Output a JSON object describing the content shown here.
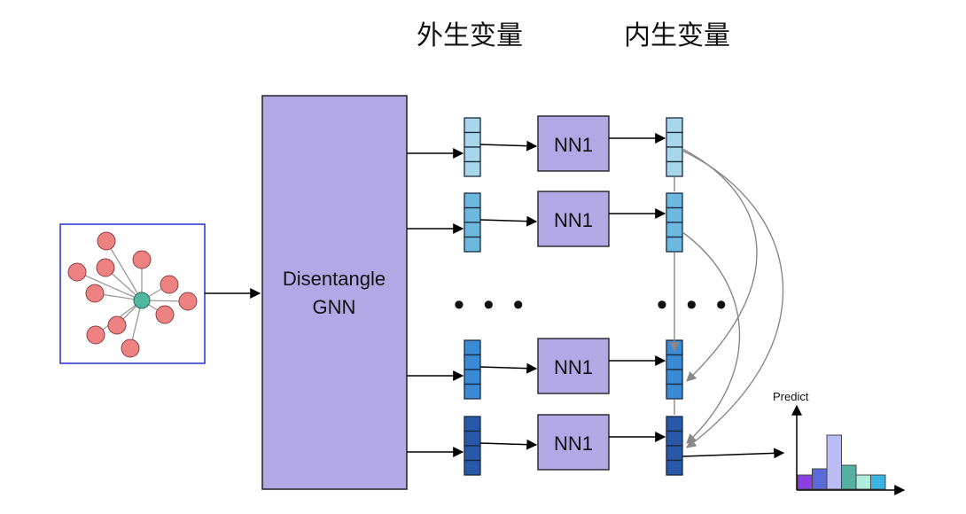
{
  "headers": {
    "exogenous": "外生变量",
    "endogenous": "内生变量"
  },
  "gnn": {
    "line1": "Disentangle",
    "line2": "GNN"
  },
  "nn_label": "NN1",
  "ellipsis": "• • •",
  "predict_label": "Predict",
  "colors": {
    "gnn_fill": "#b2a8e6",
    "nn_fill": "#b2a8e6",
    "graph_border": "#2233cc",
    "node_red": "#ee8282",
    "node_center": "#4fb89c",
    "row_colors": [
      "#a8d6ea",
      "#6cb8de",
      "#3a8ad6",
      "#2858a8"
    ],
    "histogram": [
      "#8a3ee0",
      "#5a6ad8",
      "#bcbcf5",
      "#56b0a0",
      "#b0ecdc",
      "#3ab4e0"
    ]
  }
}
